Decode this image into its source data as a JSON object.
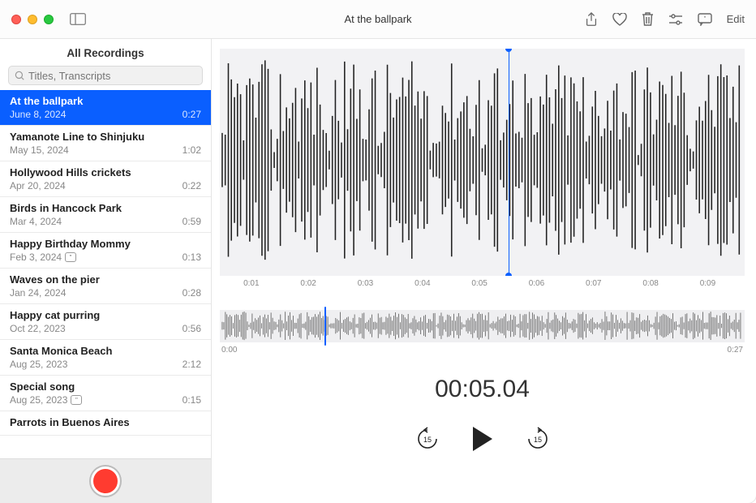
{
  "window": {
    "title": "At the ballpark",
    "edit_label": "Edit"
  },
  "sidebar": {
    "heading": "All Recordings",
    "search_placeholder": "Titles, Transcripts",
    "items": [
      {
        "title": "At the ballpark",
        "date": "June 8, 2024",
        "duration": "0:27",
        "selected": true,
        "has_transcript": false
      },
      {
        "title": "Yamanote Line to Shinjuku",
        "date": "May 15, 2024",
        "duration": "1:02",
        "selected": false,
        "has_transcript": false
      },
      {
        "title": "Hollywood Hills crickets",
        "date": "Apr 20, 2024",
        "duration": "0:22",
        "selected": false,
        "has_transcript": false
      },
      {
        "title": "Birds in Hancock Park",
        "date": "Mar 4, 2024",
        "duration": "0:59",
        "selected": false,
        "has_transcript": false
      },
      {
        "title": "Happy Birthday Mommy",
        "date": "Feb 3, 2024",
        "duration": "0:13",
        "selected": false,
        "has_transcript": true
      },
      {
        "title": "Waves on the pier",
        "date": "Jan 24, 2024",
        "duration": "0:28",
        "selected": false,
        "has_transcript": false
      },
      {
        "title": "Happy cat purring",
        "date": "Oct 22, 2023",
        "duration": "0:56",
        "selected": false,
        "has_transcript": false
      },
      {
        "title": "Santa Monica Beach",
        "date": "Aug 25, 2023",
        "duration": "2:12",
        "selected": false,
        "has_transcript": false
      },
      {
        "title": "Special song",
        "date": "Aug 25, 2023",
        "duration": "0:15",
        "selected": false,
        "has_transcript": true
      },
      {
        "title": "Parrots in Buenos Aires",
        "date": "",
        "duration": "",
        "selected": false,
        "has_transcript": false
      }
    ]
  },
  "timeline": {
    "ticks": [
      "0:01",
      "0:02",
      "0:03",
      "0:04",
      "0:05",
      "0:06",
      "0:07",
      "0:08",
      "0:09"
    ],
    "overview_start": "0:00",
    "overview_end": "0:27",
    "current_time": "00:05.04",
    "skip_seconds": "15"
  },
  "colors": {
    "selection": "#0a5fff",
    "record": "#ff3b30"
  }
}
